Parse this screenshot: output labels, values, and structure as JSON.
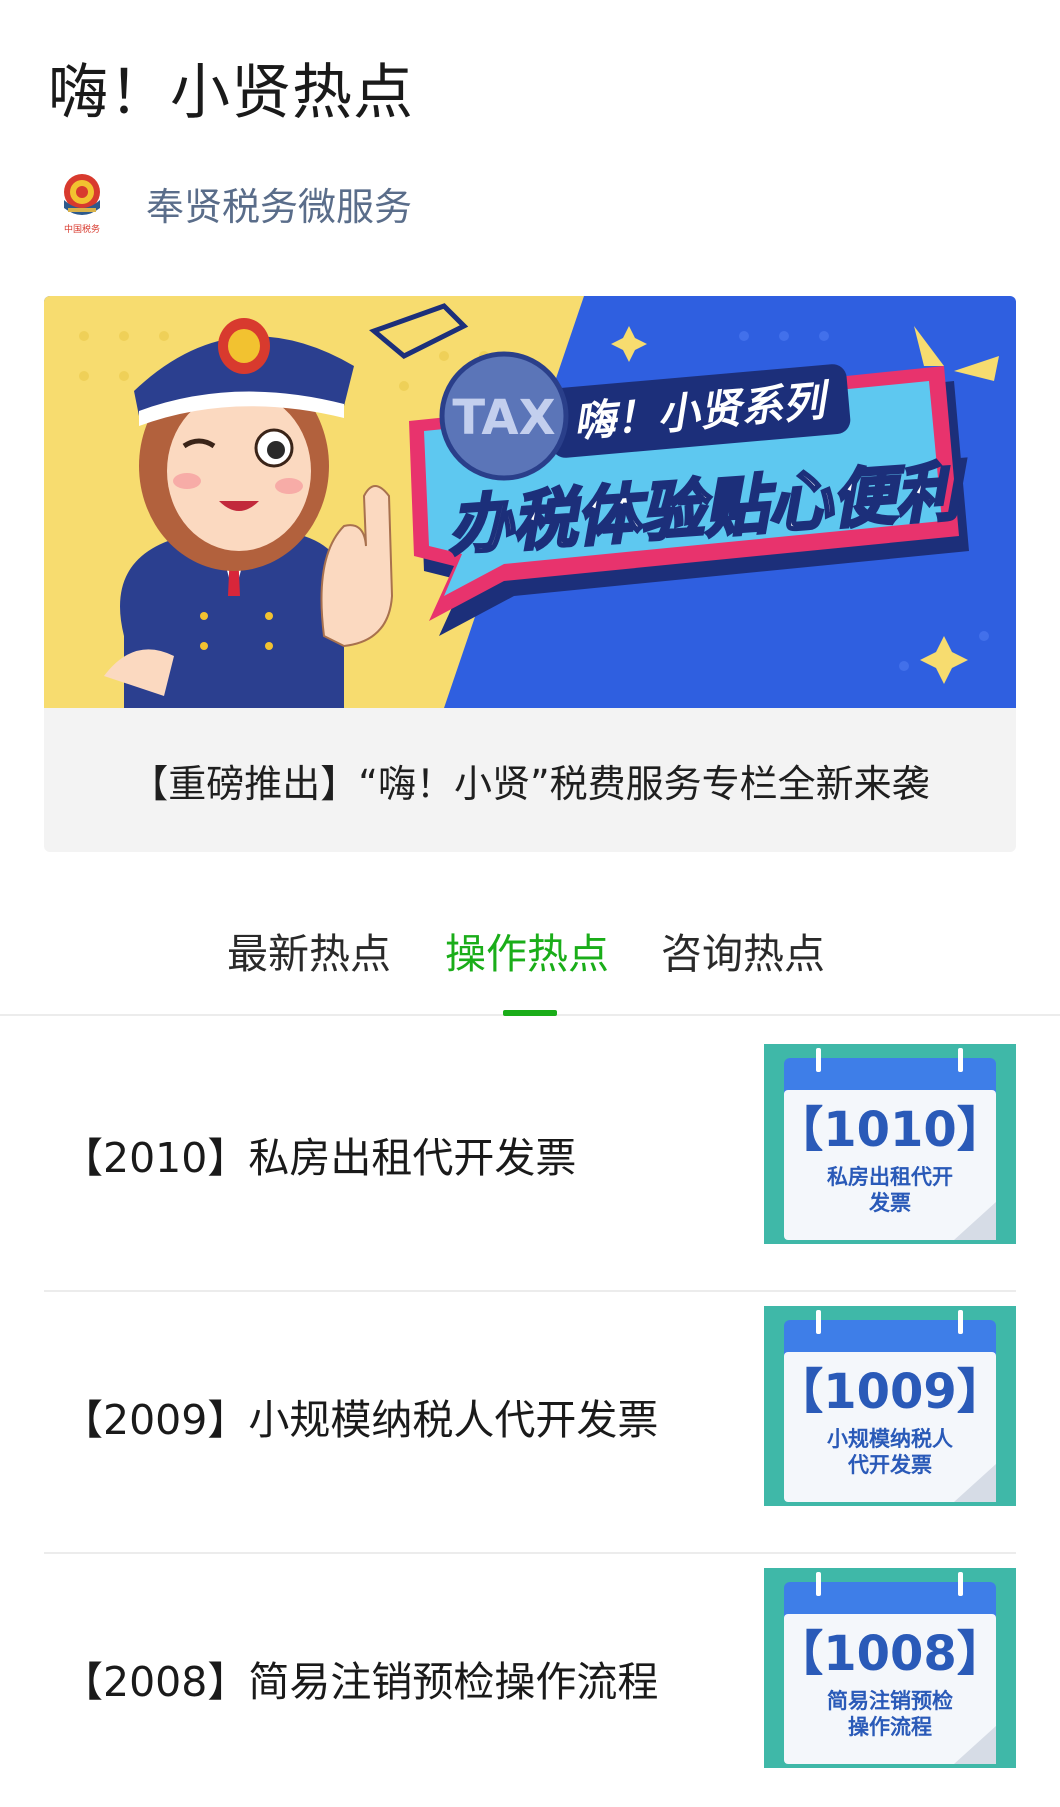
{
  "article": {
    "title": "嗨！小贤热点",
    "account_name": "奉贤税务微服务",
    "logo_caption": "中国税务"
  },
  "banner": {
    "badge_text": "TAX",
    "series_text": "嗨！小贤系列",
    "headline": "办税体验贴心便利",
    "caption": "【重磅推出】“嗨！小贤”税费服务专栏全新来袭"
  },
  "tabs": [
    {
      "label": "最新热点",
      "active": false
    },
    {
      "label": "操作热点",
      "active": true
    },
    {
      "label": "咨询热点",
      "active": false
    }
  ],
  "items": [
    {
      "title": "【2010】私房出租代开发票",
      "thumb_code": "【1010】",
      "thumb_line1": "私房出租代开",
      "thumb_line2": "发票"
    },
    {
      "title": "【2009】小规模纳税人代开发票",
      "thumb_code": "【1009】",
      "thumb_line1": "小规模纳税人",
      "thumb_line2": "代开发票"
    },
    {
      "title": "【2008】简易注销预检操作流程",
      "thumb_code": "【1008】",
      "thumb_line1": "简易注销预检",
      "thumb_line2": "操作流程"
    }
  ],
  "colors": {
    "accent_green": "#1aad19",
    "account_name": "#5a6d8a",
    "banner_blue": "#2f5fe0",
    "banner_yellow": "#f7dc6f",
    "banner_pink": "#e8336d",
    "thumb_blue": "#3e7ee8",
    "thumb_teal": "#3fb8a8"
  }
}
